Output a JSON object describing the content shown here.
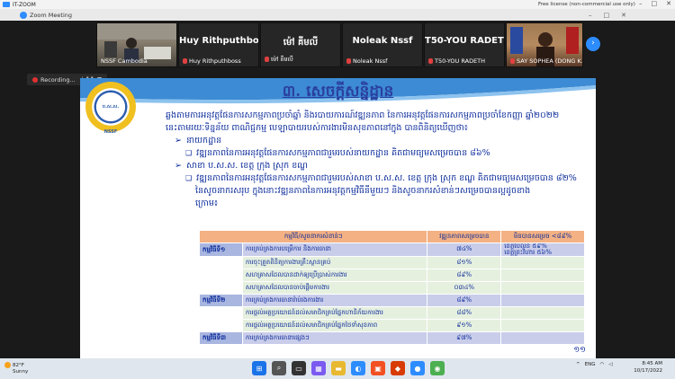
{
  "outer_window": {
    "app_title": "IT-ZOOM",
    "license_text": "Free license (non-commercial use only)"
  },
  "zoom_window": {
    "title": "Zoom Meeting"
  },
  "participants": [
    {
      "display_name": "",
      "label": "NSSF Cambodia",
      "has_video": true
    },
    {
      "display_name": "Huy Rithputhboss",
      "label": "Huy Rithputhboss",
      "muted": true
    },
    {
      "display_name": "ម៉ៅ គីមលី",
      "label": "ម៉ៅ គីមលី",
      "muted": true
    },
    {
      "display_name": "Noleak Nssf",
      "label": "Noleak Nssf",
      "muted": true
    },
    {
      "display_name": "T50-YOU RADETH",
      "label": "T50-YOU RADETH",
      "muted": true
    },
    {
      "display_name": "",
      "label": "SAY SOPHEA (DONG K...",
      "has_video": true
    }
  ],
  "recording": {
    "label": "Recording..."
  },
  "slide": {
    "badge_text": "ប.ស.ស. NSSF",
    "title": "៣. សេចក្តីសន្និដ្ឋាន",
    "intro_line1": "ឆ្លងតាមការអនុវត្តផែនការសកម្មភាពប្រចាំឆ្នាំ  និងរបាយការណ៍វឌ្ឍនភាព  នៃការអនុវត្តផែនការសកម្មភាពប្រចាំខែកញ្ញា  ឆ្នាំ២០២២",
    "intro_line2": "នេះតាមរយៈទិន្នន័យ ពាណិជ្ជកម្ម បេឡាបាយរបស់ការងារមិនសុខភាពនៅក្នុង បានពិនិត្យឃើញថា៖",
    "bullet1": "នាយកដ្ឋាន",
    "bullet1_sub": "វឌ្ឍនភាពនៃការអនុវត្តផែនការសកម្មភាពជារួមរបស់នាយកដ្ឋាន គិតជាមធ្យមសម្រេចបាន ៨៦%",
    "bullet2": "សាខា ប.ស.ស. ខេត្ត ក្រុង ស្រុក ខណ្ឌ",
    "bullet2_sub_line1": "វឌ្ឍនភាពនៃការអនុវត្តផែនការសកម្មភាពជារួមរបស់សាខា ប.ស.ស. ខេត្ត ក្រុង ស្រុក ខណ្ឌ គិតជាមធ្យមសម្រេចបាន ៨២%",
    "bullet2_sub_line2": "នៃសូចនាករសរុប    ក្នុងនោះវឌ្ឍនភាពនៃការអនុវត្តកម្មវិធីនីមួយៗ   និងសូចនាករសំខាន់ៗសម្រេចបានល្អដូចខាង",
    "bullet2_sub_line3": "ក្រោម៖",
    "page_number": "១១"
  },
  "table": {
    "headers": [
      "កម្មវិធី/សូចនាករសំខាន់ៗ",
      "វឌ្ឍនភាពសម្រេចបាន",
      "មិនបានសម្រេច <៨៩%"
    ],
    "rows": [
      {
        "program": "កម្មវិធីទី១",
        "indicator": "ការគ្រប់គ្រងការបម្រើការ និងការធានា",
        "progress": "៧៤%",
        "not_achieved_1": "ខេត្តប៉ៃលិន ៥៩%",
        "not_achieved_2": "ខេត្តព្រះវិហារ ៥៦%",
        "type": "main"
      },
      {
        "program": "",
        "indicator": "ការចុះត្រួតពិនិត្យការងារគ្រឹះស្ថានគ្រប់",
        "progress": "៨១%",
        "not_achieved_1": "",
        "not_achieved_2": "",
        "type": "sub"
      },
      {
        "program": "",
        "indicator": "សហគ្រាសដែលបានដាក់ឲ្យប្រើប្រាស់ការងារ",
        "progress": "៨៩%",
        "not_achieved_1": "",
        "not_achieved_2": "",
        "type": "sub"
      },
      {
        "program": "",
        "indicator": "សហគ្រាសដែលបានចាប់ផ្តើមការងារ",
        "progress": "០៣៤%",
        "not_achieved_1": "",
        "not_achieved_2": "",
        "type": "sub"
      },
      {
        "program": "កម្មវិធីទី២",
        "indicator": "ការគ្រប់គ្រងការធានារ៉ាប់រងការងារ",
        "progress": "៨៩%",
        "not_achieved_1": "",
        "not_achieved_2": "",
        "type": "main"
      },
      {
        "program": "",
        "indicator": "ការផ្តល់អត្ថប្រយោជន៍ដល់សមាជិកគ្រប់ផ្នែកហានិភ័យការងារ",
        "progress": "៨៨%",
        "not_achieved_1": "",
        "not_achieved_2": "",
        "type": "sub"
      },
      {
        "program": "",
        "indicator": "ការផ្តល់អត្ថប្រយោជន៍ដល់សមាជិកគ្រប់ផ្នែកថែទាំសុខភាព",
        "progress": "៩១%",
        "not_achieved_1": "",
        "not_achieved_2": "",
        "type": "sub"
      },
      {
        "program": "កម្មវិធីទី៣",
        "indicator": "ការគ្រប់គ្រងការធានាផ្សេងៗ",
        "progress": "៩៧%",
        "not_achieved_1": "",
        "not_achieved_2": "",
        "type": "main"
      }
    ]
  },
  "taskbar": {
    "weather_temp": "82°F",
    "weather_desc": "Sunny",
    "lang": "ENG",
    "time": "8:45 AM",
    "date": "10/17/2022"
  },
  "colors": {
    "zoom_blue": "#2d8cff",
    "slide_text": "#0a2a9a",
    "table_header": "#f4b183",
    "table_main_row": "#c9cdea",
    "table_sub_row": "#e6f0df"
  }
}
